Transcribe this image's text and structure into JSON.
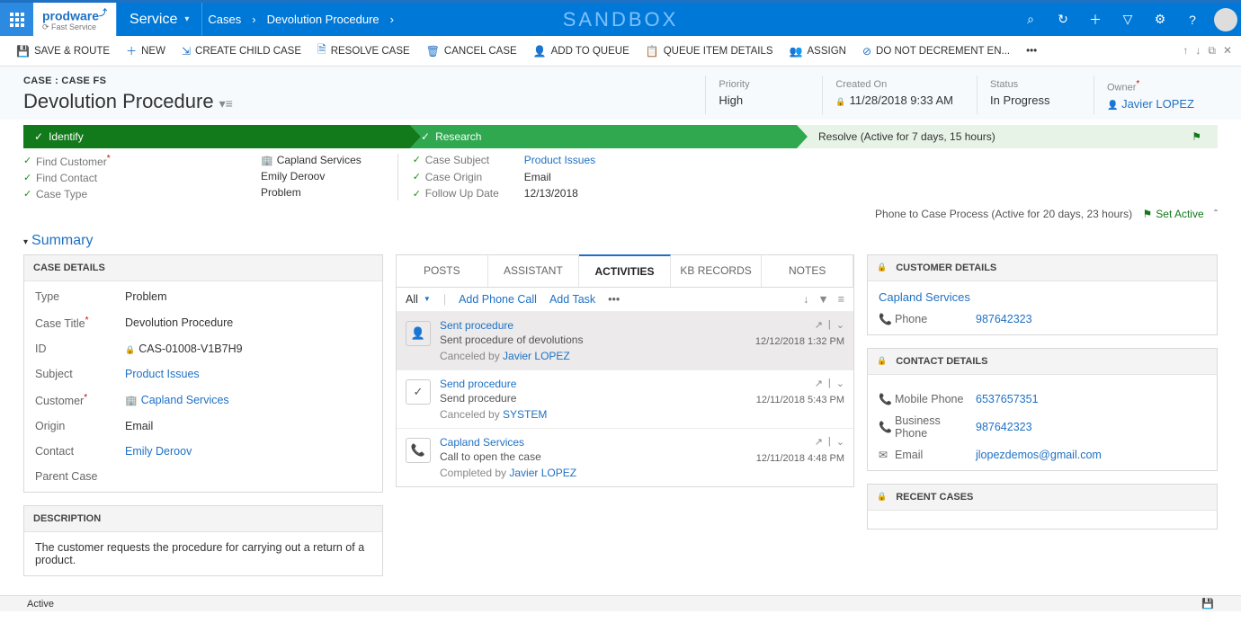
{
  "nav": {
    "service": "Service",
    "crumbs": [
      "Cases",
      "Devolution Procedure"
    ],
    "sandbox": "SANDBOX"
  },
  "cmd": {
    "save_route": "SAVE & ROUTE",
    "new": "NEW",
    "create_child": "CREATE CHILD CASE",
    "resolve": "RESOLVE CASE",
    "cancel": "CANCEL CASE",
    "add_queue": "ADD TO QUEUE",
    "queue_details": "QUEUE ITEM DETAILS",
    "assign": "ASSIGN",
    "no_decrement": "DO NOT DECREMENT EN..."
  },
  "header": {
    "pretitle": "CASE : CASE FS",
    "title": "Devolution Procedure",
    "priority_lbl": "Priority",
    "priority": "High",
    "created_lbl": "Created On",
    "created": "11/28/2018  9:33 AM",
    "status_lbl": "Status",
    "status": "In Progress",
    "owner_lbl": "Owner",
    "owner": "Javier LOPEZ"
  },
  "process": {
    "s1": "Identify",
    "s2": "Research",
    "s3": "Resolve (Active for 7 days, 15 hours)",
    "bar": "Phone to Case Process (Active for 20 days, 23 hours)",
    "set_active": "Set Active"
  },
  "pfields": {
    "find_cust": "Find Customer",
    "find_cust_v": "Capland Services",
    "find_contact": "Find Contact",
    "find_contact_v": "Emily Deroov",
    "case_type": "Case Type",
    "case_type_v": "Problem",
    "case_subject": "Case Subject",
    "case_subject_v": "Product Issues",
    "case_origin": "Case Origin",
    "case_origin_v": "Email",
    "followup": "Follow Up Date",
    "followup_v": "12/13/2018"
  },
  "summary_label": "Summary",
  "case_details": {
    "hdr": "CASE DETAILS",
    "type_l": "Type",
    "type_v": "Problem",
    "title_l": "Case Title",
    "title_v": "Devolution Procedure",
    "id_l": "ID",
    "id_v": "CAS-01008-V1B7H9",
    "subject_l": "Subject",
    "subject_v": "Product Issues",
    "customer_l": "Customer",
    "customer_v": "Capland Services",
    "origin_l": "Origin",
    "origin_v": "Email",
    "contact_l": "Contact",
    "contact_v": "Emily Deroov",
    "parent_l": "Parent Case",
    "parent_v": ""
  },
  "description": {
    "hdr": "DESCRIPTION",
    "text": "The customer requests the procedure for carrying out a return of a product."
  },
  "tabs": {
    "posts": "POSTS",
    "assistant": "ASSISTANT",
    "activities": "ACTIVITIES",
    "kb": "KB RECORDS",
    "notes": "NOTES"
  },
  "act_tb": {
    "all": "All",
    "add_call": "Add Phone Call",
    "add_task": "Add Task"
  },
  "activities": [
    {
      "title": "Sent procedure",
      "sub": "Sent procedure of devolutions",
      "meta_pre": "Canceled by",
      "meta_who": "Javier LOPEZ",
      "time": "12/12/2018 1:32 PM",
      "icon": "person"
    },
    {
      "title": "Send procedure",
      "sub": "Send procedure",
      "meta_pre": "Canceled by",
      "meta_who": "SYSTEM",
      "time": "12/11/2018 5:43 PM",
      "icon": "check"
    },
    {
      "title": "Capland Services",
      "sub": "Call to open the case",
      "meta_pre": "Completed by",
      "meta_who": "Javier LOPEZ",
      "time": "12/11/2018 4:48 PM",
      "icon": "phone"
    }
  ],
  "customer": {
    "hdr": "CUSTOMER DETAILS",
    "name": "Capland Services",
    "phone_l": "Phone",
    "phone": "987642323"
  },
  "contact": {
    "hdr": "CONTACT DETAILS",
    "mobile_l": "Mobile Phone",
    "mobile": "6537657351",
    "biz_l": "Business Phone",
    "biz": "987642323",
    "email_l": "Email",
    "email": "jlopezdemos@gmail.com"
  },
  "recent": {
    "hdr": "RECENT CASES"
  },
  "footer": {
    "status": "Active"
  }
}
